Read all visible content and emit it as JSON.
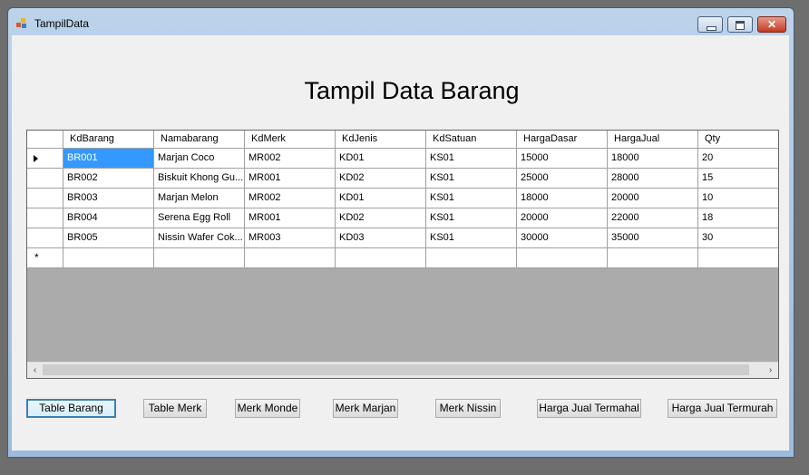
{
  "window": {
    "title": "TampilData",
    "close_glyph": "✕"
  },
  "heading": "Tampil Data Barang",
  "grid": {
    "columns": [
      "KdBarang",
      "Namabarang",
      "KdMerk",
      "KdJenis",
      "KdSatuan",
      "HargaDasar",
      "HargaJual",
      "Qty"
    ],
    "rows": [
      [
        "BR001",
        "Marjan Coco",
        "MR002",
        "KD01",
        "KS01",
        "15000",
        "18000",
        "20"
      ],
      [
        "BR002",
        "Biskuit Khong Gu...",
        "MR001",
        "KD02",
        "KS01",
        "25000",
        "28000",
        "15"
      ],
      [
        "BR003",
        "Marjan Melon",
        "MR002",
        "KD01",
        "KS01",
        "18000",
        "20000",
        "10"
      ],
      [
        "BR004",
        "Serena Egg Roll",
        "MR001",
        "KD02",
        "KS01",
        "20000",
        "22000",
        "18"
      ],
      [
        "BR005",
        "Nissin Wafer Cok...",
        "MR003",
        "KD03",
        "KS01",
        "30000",
        "35000",
        "30"
      ]
    ],
    "new_row_marker": "*",
    "scroll_left": "‹",
    "scroll_right": "›"
  },
  "buttons": [
    "Table Barang",
    "Table Merk",
    "Merk Monde",
    "Merk Marjan",
    "Merk Nissin",
    "Harga Jual Termahal",
    "Harga Jual Termurah"
  ],
  "colors": {
    "selection": "#3399ff",
    "grid_background": "#ababab",
    "form_background": "#f0f0f0"
  }
}
